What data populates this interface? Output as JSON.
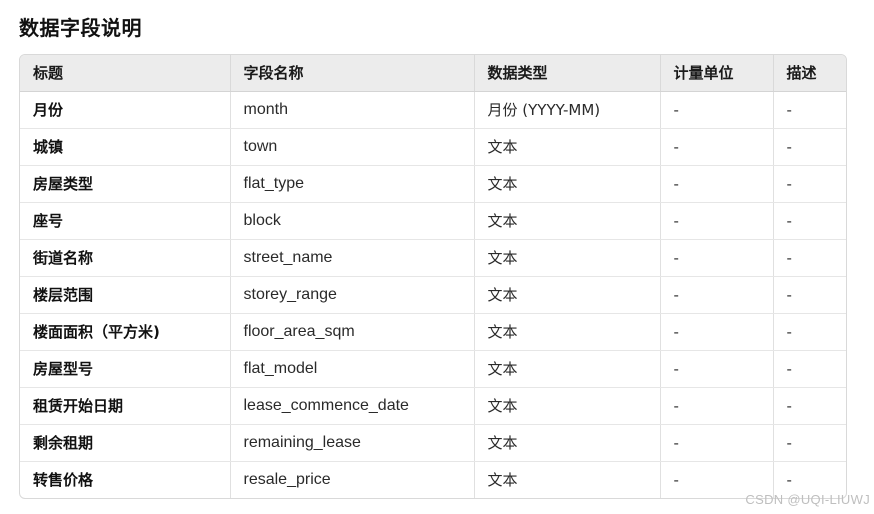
{
  "page": {
    "title": "数据字段说明"
  },
  "table": {
    "headers": [
      "标题",
      "字段名称",
      "数据类型",
      "计量单位",
      "描述"
    ],
    "rows": [
      {
        "title": "月份",
        "field": "month",
        "type": "月份 (YYYY-MM)",
        "unit": "-",
        "desc": "-"
      },
      {
        "title": "城镇",
        "field": "town",
        "type": "文本",
        "unit": "-",
        "desc": "-"
      },
      {
        "title": "房屋类型",
        "field": "flat_type",
        "type": "文本",
        "unit": "-",
        "desc": "-"
      },
      {
        "title": "座号",
        "field": "block",
        "type": "文本",
        "unit": "-",
        "desc": "-"
      },
      {
        "title": "街道名称",
        "field": "street_name",
        "type": "文本",
        "unit": "-",
        "desc": "-"
      },
      {
        "title": "楼层范围",
        "field": "storey_range",
        "type": "文本",
        "unit": "-",
        "desc": "-"
      },
      {
        "title": "楼面面积（平方米)",
        "field": "floor_area_sqm",
        "type": "文本",
        "unit": "-",
        "desc": "-"
      },
      {
        "title": "房屋型号",
        "field": "flat_model",
        "type": "文本",
        "unit": "-",
        "desc": "-"
      },
      {
        "title": "租赁开始日期",
        "field": "lease_commence_date",
        "type": "文本",
        "unit": "-",
        "desc": "-"
      },
      {
        "title": "剩余租期",
        "field": "remaining_lease",
        "type": "文本",
        "unit": "-",
        "desc": "-"
      },
      {
        "title": "转售价格",
        "field": "resale_price",
        "type": "文本",
        "unit": "-",
        "desc": "-"
      }
    ]
  },
  "watermark": "CSDN @UQI-LIUWJ"
}
